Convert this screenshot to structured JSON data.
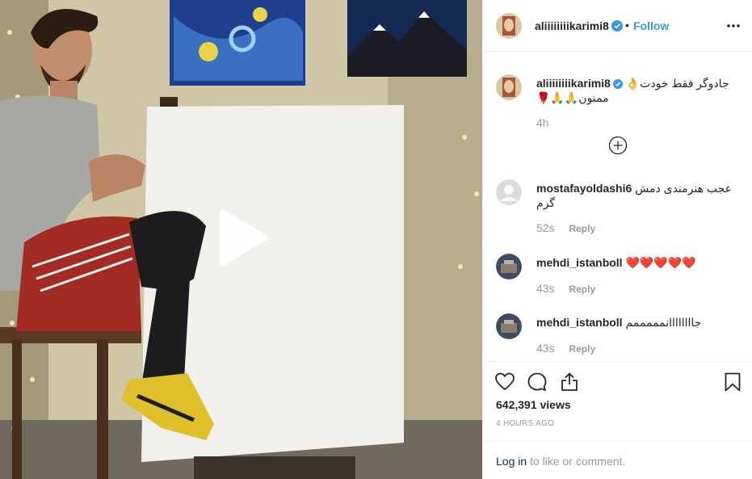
{
  "post": {
    "username": "aliiiiiiiikarimi8",
    "follow_label": "Follow",
    "dot": "•",
    "caption_line1": "جادوگر فقط خودت👌",
    "caption_line2": "ممنون🙏🙏🌹",
    "caption_time": "4h"
  },
  "comments": [
    {
      "username": "mostafayoldashi6",
      "text": "عجب هنرمندی دمش گرم",
      "time": "52s",
      "reply_label": "Reply"
    },
    {
      "username": "mehdi_istanboll",
      "text": "❤️❤️❤️❤️❤️",
      "time": "43s",
      "reply_label": "Reply"
    },
    {
      "username": "mehdi_istanboll",
      "text": "جاااااااانمممممم",
      "time": "43s",
      "reply_label": "Reply"
    }
  ],
  "stats": {
    "views": "642,391 views",
    "time_ago": "4 HOURS AGO"
  },
  "footer": {
    "login_label": "Log in",
    "login_rest": " to like or comment."
  },
  "icons": {
    "more": "more-icon",
    "play": "play-icon",
    "heart": "heart-icon",
    "comment": "comment-icon",
    "share": "share-icon",
    "bookmark": "bookmark-icon",
    "add": "plus-circle-icon",
    "verified": "verified-badge-icon"
  },
  "colors": {
    "link_blue": "#3897f0",
    "verified_blue": "#3897f0",
    "muted": "#999999",
    "login": "#003569"
  }
}
